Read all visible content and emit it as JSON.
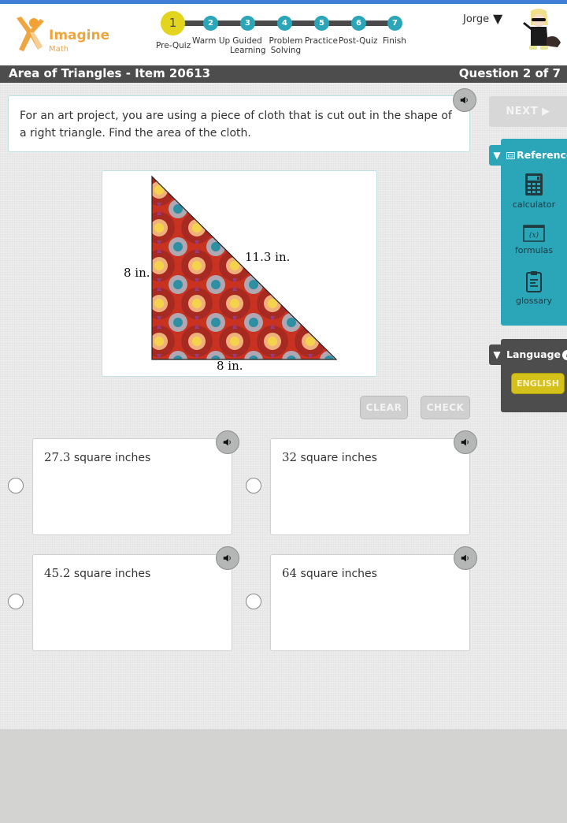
{
  "header": {
    "logo": {
      "brand": "Imagine",
      "sub": "Math",
      "icon": "imagine-math-logo-icon"
    },
    "progress": {
      "current_step": 1,
      "steps": [
        {
          "number": "1",
          "label": "Pre-Quiz"
        },
        {
          "number": "2",
          "label": "Warm Up"
        },
        {
          "number": "3",
          "label": "Guided Learning"
        },
        {
          "number": "4",
          "label": "Problem Solving"
        },
        {
          "number": "5",
          "label": "Practice"
        },
        {
          "number": "6",
          "label": "Post-Quiz"
        },
        {
          "number": "7",
          "label": "Finish"
        }
      ]
    },
    "user": {
      "name": "Jorge",
      "caret": "▼",
      "avatar_icon": "avatar-character-icon"
    }
  },
  "titlebar": {
    "lesson_title": "Area of Triangles - Item 20613",
    "question_counter": "Question 2 of 7"
  },
  "question": {
    "text": "For an art project, you are using a piece of cloth that is cut out in the shape of a right triangle. Find the area of the cloth.",
    "audio_icon": "speaker-icon"
  },
  "figure": {
    "shape": "right triangle (patterned cloth)",
    "labels": {
      "height": "8 in.",
      "base": "8 in.",
      "hypotenuse": "11.3 in."
    }
  },
  "actions": {
    "clear": "CLEAR",
    "check": "CHECK"
  },
  "answers": [
    {
      "value": "27.3",
      "unit": "square inches",
      "selected": false
    },
    {
      "value": "32",
      "unit": "square inches",
      "selected": false
    },
    {
      "value": "45.2",
      "unit": "square inches",
      "selected": false
    },
    {
      "value": "64",
      "unit": "square inches",
      "selected": false
    }
  ],
  "sidebar": {
    "next": "NEXT ▶",
    "reference": {
      "title": "Reference",
      "toggle": "▼",
      "items": [
        {
          "label": "calculator",
          "icon": "calculator-icon"
        },
        {
          "label": "formulas",
          "icon": "formulas-icon",
          "glyph": "(x)"
        },
        {
          "label": "glossary",
          "icon": "clipboard-icon"
        }
      ]
    },
    "language": {
      "title": "Language",
      "toggle": "▼",
      "info": "i",
      "current": "ENGLISH"
    }
  },
  "colors": {
    "accent_teal": "#2ba5b8",
    "current_step_yellow": "#e2d41f",
    "titlebar_gray": "#4c4d4c",
    "brand_orange": "#eea53a",
    "top_blue": "#3f7fd6"
  }
}
